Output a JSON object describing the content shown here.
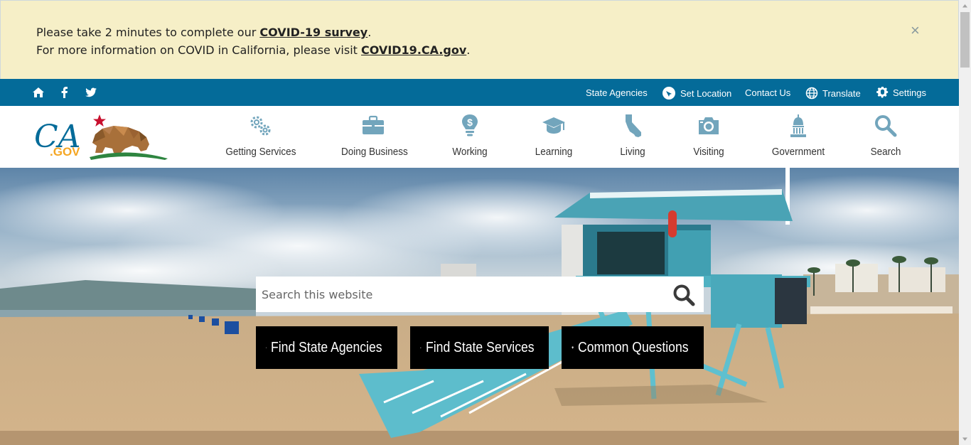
{
  "alert": {
    "line1_prefix": "Please take 2 minutes to complete our ",
    "line1_link": "COVID-19 survey",
    "line1_suffix": ".",
    "line2_prefix": "For more information on COVID in California, please visit ",
    "line2_link": "COVID19.CA.gov",
    "line2_suffix": ".",
    "close": "×"
  },
  "utility": {
    "icons": [
      "home-icon",
      "facebook-icon",
      "twitter-icon"
    ],
    "links": {
      "state_agencies": "State Agencies",
      "set_location": "Set Location",
      "contact_us": "Contact Us",
      "translate": "Translate",
      "settings": "Settings"
    }
  },
  "logo": {
    "text": "CA",
    "sub": ".GOV"
  },
  "nav": {
    "getting_services": "Getting Services",
    "doing_business": "Doing Business",
    "working": "Working",
    "learning": "Learning",
    "living": "Living",
    "visiting": "Visiting",
    "government": "Government",
    "search": "Search"
  },
  "hero": {
    "search_placeholder": "Search this website",
    "cta": {
      "agencies": "Find State Agencies",
      "services": "Find State Services",
      "questions": "Common Questions"
    }
  },
  "colors": {
    "alert_bg": "#f6efc7",
    "utility_bg": "#046b99",
    "nav_icon": "#72a5bc",
    "cta_bg": "#000000"
  }
}
